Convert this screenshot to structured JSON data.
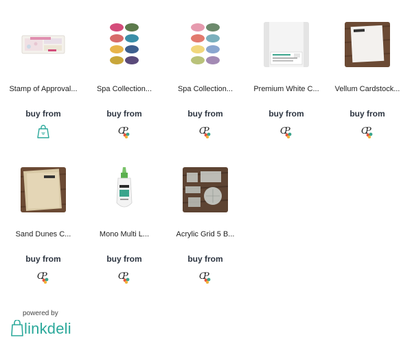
{
  "products": [
    {
      "title": "Stamp of Approval...",
      "buy_label": "buy from",
      "thumb_icon": "stamp-set-image",
      "shop_icon": "shopping-bag-icon"
    },
    {
      "title": "Spa Collection...",
      "buy_label": "buy from",
      "thumb_icon": "ink-pads-image",
      "shop_icon": "retailer-logo-icon"
    },
    {
      "title": "Spa Collection...",
      "buy_label": "buy from",
      "thumb_icon": "ink-pads-image",
      "shop_icon": "retailer-logo-icon"
    },
    {
      "title": "Premium White C...",
      "buy_label": "buy from",
      "thumb_icon": "cardstock-image",
      "shop_icon": "retailer-logo-icon"
    },
    {
      "title": "Vellum Cardstock...",
      "buy_label": "buy from",
      "thumb_icon": "vellum-image",
      "shop_icon": "retailer-logo-icon"
    },
    {
      "title": "Sand Dunes C...",
      "buy_label": "buy from",
      "thumb_icon": "sand-cardstock-image",
      "shop_icon": "retailer-logo-icon"
    },
    {
      "title": "Mono Multi L...",
      "buy_label": "buy from",
      "thumb_icon": "glue-bottle-image",
      "shop_icon": "retailer-logo-icon"
    },
    {
      "title": "Acrylic Grid 5 B...",
      "buy_label": "buy from",
      "thumb_icon": "acrylic-blocks-image",
      "shop_icon": "retailer-logo-icon"
    }
  ],
  "footer": {
    "powered_by": "powered by",
    "brand": "linkdeli",
    "brand_color": "#2aa89a"
  },
  "colors": {
    "buy_text": "#2c3440",
    "accent": "#2aa89a"
  }
}
